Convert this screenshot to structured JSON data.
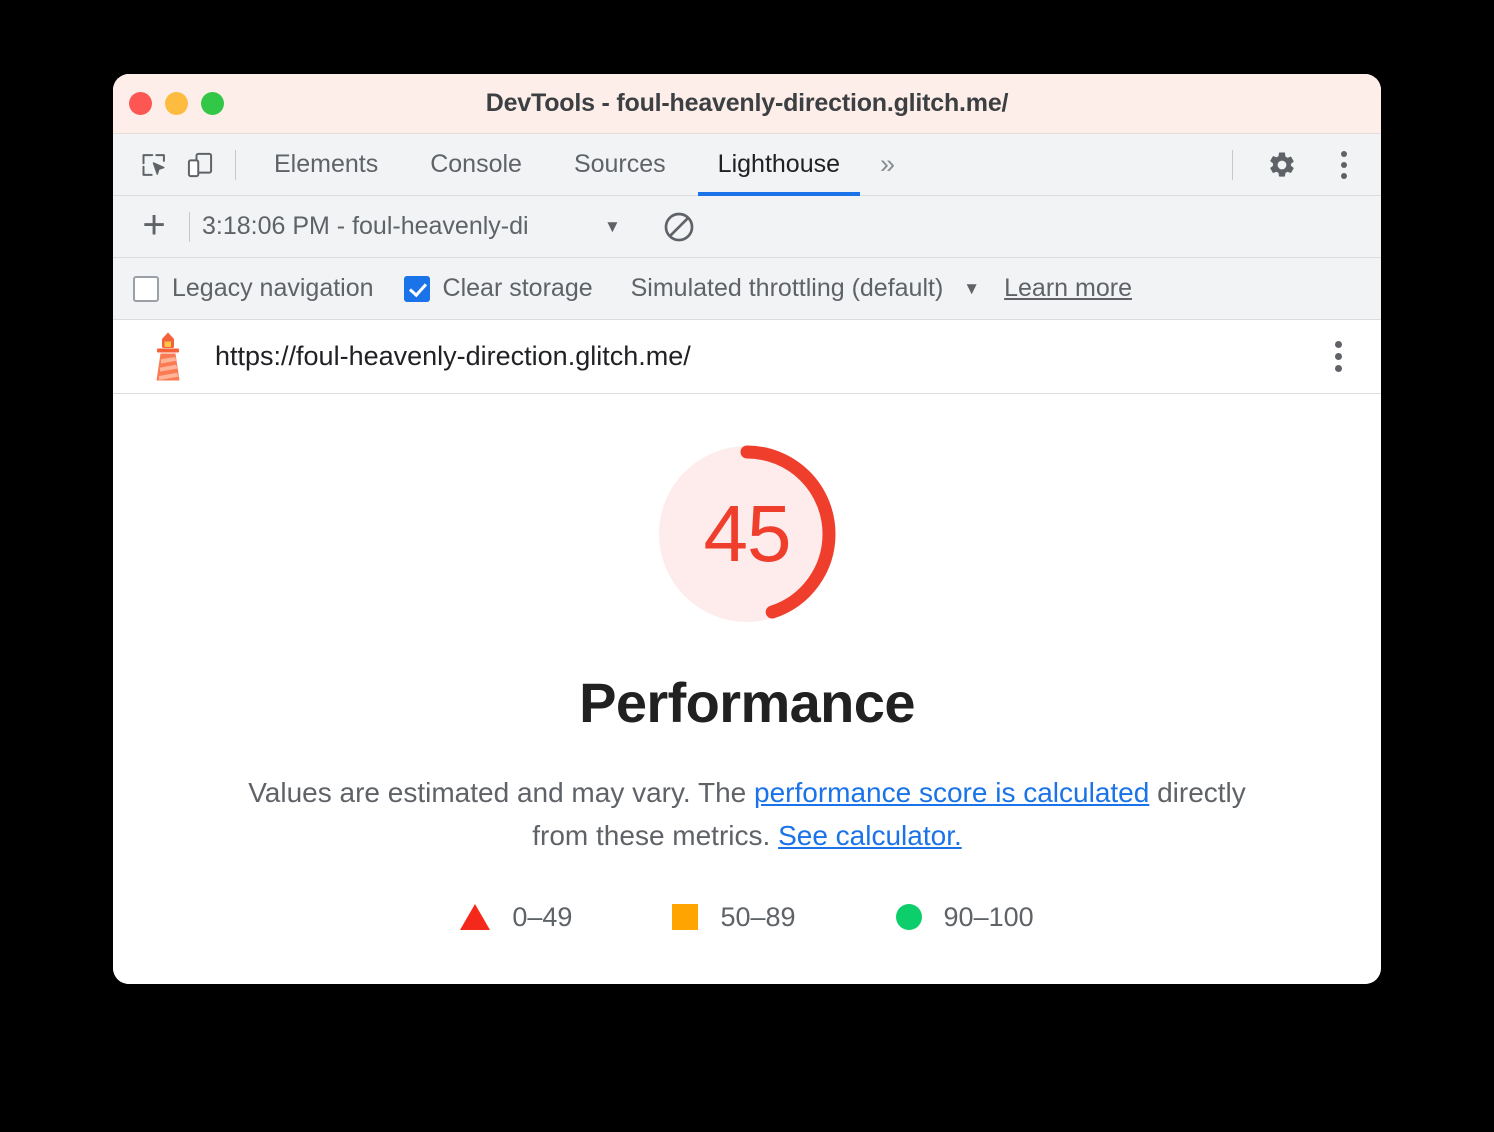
{
  "window": {
    "title": "DevTools - foul-heavenly-direction.glitch.me/",
    "traffic_lights": [
      "close",
      "minimize",
      "zoom"
    ]
  },
  "toolbar": {
    "inspect_icon": "inspect-element-icon",
    "device_icon": "device-toolbar-icon",
    "tabs": [
      {
        "label": "Elements",
        "active": false
      },
      {
        "label": "Console",
        "active": false
      },
      {
        "label": "Sources",
        "active": false
      },
      {
        "label": "Lighthouse",
        "active": true
      }
    ],
    "more_tabs_label": "»",
    "settings_icon": "gear-icon",
    "menu_icon": "vertical-dots-icon"
  },
  "report_bar": {
    "add_label": "+",
    "selected_report": "3:18:06 PM - foul-heavenly-di",
    "caret": "▼",
    "clear_icon": "clear-all-icon"
  },
  "settings": {
    "legacy_navigation": {
      "label": "Legacy navigation",
      "checked": false
    },
    "clear_storage": {
      "label": "Clear storage",
      "checked": true
    },
    "throttling": {
      "label": "Simulated throttling (default)",
      "caret": "▼"
    },
    "learn_more": "Learn more"
  },
  "url_row": {
    "lighthouse_icon": "lighthouse-icon",
    "url": "https://foul-heavenly-direction.glitch.me/",
    "menu_icon": "vertical-dots-icon"
  },
  "report": {
    "score": "45",
    "category": "Performance",
    "description_part1": "Values are estimated and may vary. The ",
    "description_link1": "performance score is calculated",
    "description_part2": " directly from these metrics. ",
    "description_link2": "See calculator.",
    "legend": [
      {
        "shape": "triangle",
        "range": "0–49",
        "color": "#f5291b"
      },
      {
        "shape": "square",
        "range": "50–89",
        "color": "#ffa400"
      },
      {
        "shape": "circle",
        "range": "90–100",
        "color": "#0cce6b"
      }
    ]
  },
  "chart_data": {
    "type": "gauge",
    "title": "Performance",
    "value": 45,
    "min": 0,
    "max": 100,
    "score_color": "#f03e2d",
    "track_color": "#fdeceb",
    "bands": [
      {
        "label": "0–49",
        "from": 0,
        "to": 49,
        "color": "#f5291b",
        "shape": "triangle"
      },
      {
        "label": "50–89",
        "from": 50,
        "to": 89,
        "color": "#ffa400",
        "shape": "square"
      },
      {
        "label": "90–100",
        "from": 90,
        "to": 100,
        "color": "#0cce6b",
        "shape": "circle"
      }
    ]
  },
  "colors": {
    "titlebar_bg": "#fdeeea",
    "toolbar_bg": "#f1f3f4",
    "accent_blue": "#1a73e8",
    "link_blue": "#1a73e8",
    "score_red": "#f03e2d"
  }
}
